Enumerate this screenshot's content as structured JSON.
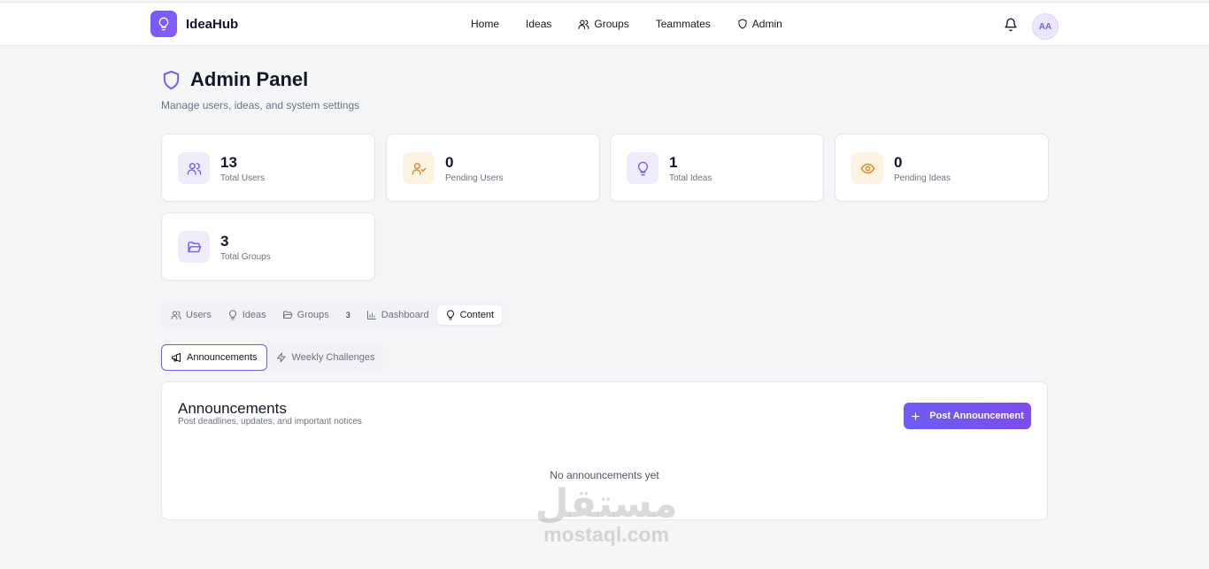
{
  "brand": {
    "name": "IdeaHub",
    "accent": "#6d5df5"
  },
  "nav": {
    "items": [
      {
        "label": "Home",
        "icon": ""
      },
      {
        "label": "Ideas",
        "icon": ""
      },
      {
        "label": "Groups",
        "icon": "users-icon"
      },
      {
        "label": "Teammates",
        "icon": ""
      },
      {
        "label": "Admin",
        "icon": "shield-icon"
      }
    ],
    "avatar_initials": "AA"
  },
  "page": {
    "title": "Admin Panel",
    "subtitle": "Manage users, ideas, and system settings"
  },
  "stats": [
    {
      "value": "13",
      "label": "Total Users",
      "icon": "users-icon",
      "tone": "purple"
    },
    {
      "value": "0",
      "label": "Pending Users",
      "icon": "user-check-icon",
      "tone": "amber"
    },
    {
      "value": "1",
      "label": "Total Ideas",
      "icon": "lightbulb-icon",
      "tone": "purple"
    },
    {
      "value": "0",
      "label": "Pending Ideas",
      "icon": "eye-icon",
      "tone": "amber"
    },
    {
      "value": "3",
      "label": "Total Groups",
      "icon": "folder-open-icon",
      "tone": "purple"
    }
  ],
  "tabs": [
    {
      "label": "Users",
      "icon": "users-icon"
    },
    {
      "label": "Ideas",
      "icon": "lightbulb-icon"
    },
    {
      "label": "Groups",
      "icon": "folder-open-icon",
      "count": "3"
    },
    {
      "label": "Dashboard",
      "icon": "bar-chart-icon"
    },
    {
      "label": "Content",
      "icon": "lightbulb-icon",
      "active": true
    }
  ],
  "subtabs": [
    {
      "label": "Announcements",
      "icon": "megaphone-icon",
      "active": true
    },
    {
      "label": "Weekly Challenges",
      "icon": "zap-icon"
    }
  ],
  "announcements": {
    "title": "Announcements",
    "subtitle": "Post deadlines, updates, and important notices",
    "button_label": "Post Announcement",
    "empty_text": "No announcements yet"
  },
  "watermark": {
    "arabic": "مستقل",
    "latin": "mostaql.com"
  }
}
